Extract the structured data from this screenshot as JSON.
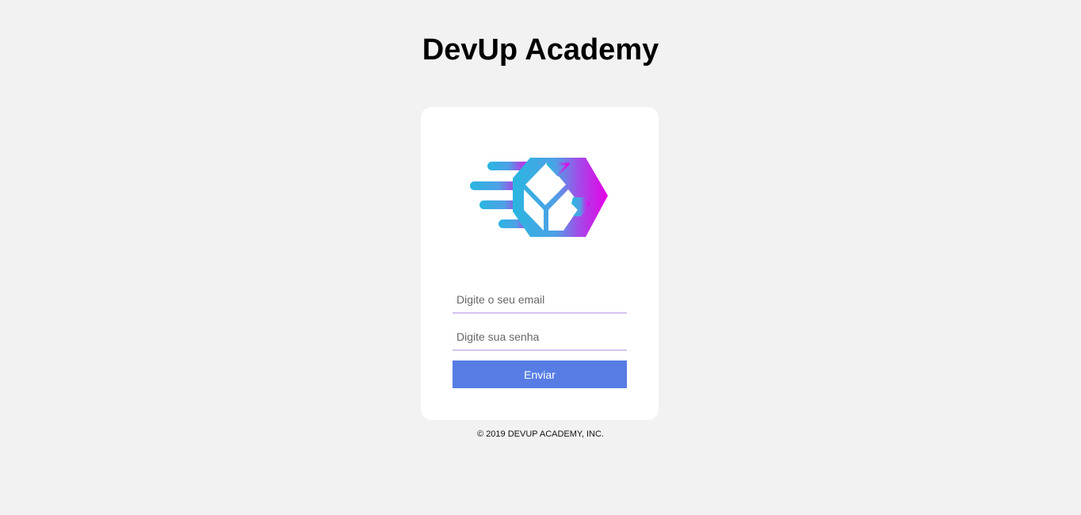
{
  "header": {
    "title": "DevUp Academy"
  },
  "logo": {
    "icon": "devup-cube-logo-icon",
    "gradient_start": "#29b6e0",
    "gradient_end": "#e600e6"
  },
  "login_form": {
    "email_placeholder": "Digite o seu email",
    "email_value": "",
    "password_placeholder": "Digite sua senha",
    "password_value": "",
    "submit_label": "Enviar"
  },
  "footer": {
    "copyright": "© 2019 DEVUP ACADEMY, INC."
  },
  "colors": {
    "background": "#f2f2f2",
    "card": "#ffffff",
    "button": "#577de4",
    "input_underline": "#d5c3ee"
  }
}
